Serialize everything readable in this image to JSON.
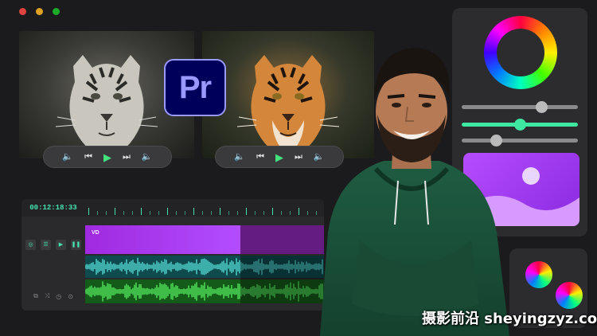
{
  "window": {
    "traffic_lights": [
      "#e0443e",
      "#dea123",
      "#1aab29"
    ]
  },
  "app_logo": {
    "text": "Pr",
    "name": "Adobe Premiere Pro"
  },
  "previews": [
    {
      "id": "original",
      "style": "desaturated"
    },
    {
      "id": "graded",
      "style": "color-graded"
    }
  ],
  "player_controls": {
    "volume": "🔈",
    "prev": "⏮",
    "play": "▶",
    "next": "⏭",
    "volume_right": "🔈"
  },
  "timeline": {
    "timecode": "00:12:18:33",
    "video_clip_label": "VD",
    "track_buttons": [
      "◎",
      "☰",
      "▶",
      "❚❚"
    ],
    "track_buttons2": [
      "⧉",
      "⤨",
      "◷",
      "⊙"
    ]
  },
  "color_panel": {
    "sliders": [
      {
        "level": 0.68,
        "color": "gray"
      },
      {
        "level": 0.5,
        "color": "green"
      },
      {
        "level": 0.3,
        "color": "gray"
      }
    ]
  },
  "watermark": "摄影前沿 sheyingzyz.com"
}
